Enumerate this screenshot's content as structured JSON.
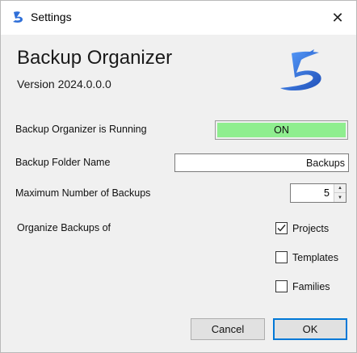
{
  "window": {
    "title": "Settings",
    "close_symbol": "✕"
  },
  "header": {
    "app_name": "Backup Organizer",
    "version": "Version 2024.0.0.0",
    "logo_icon": "stylized-b-logo-icon"
  },
  "form": {
    "running_label": "Backup Organizer is Running",
    "running_status": "ON",
    "running_status_color": "#8fee8f",
    "folder_label": "Backup Folder Name",
    "folder_value": "Backups",
    "max_label": "Maximum Number of Backups",
    "max_value": "5",
    "organize_label": "Organize Backups of",
    "options": [
      {
        "label": "Projects",
        "checked": true
      },
      {
        "label": "Templates",
        "checked": false
      },
      {
        "label": "Families",
        "checked": false
      }
    ]
  },
  "buttons": {
    "cancel": "Cancel",
    "ok": "OK"
  },
  "colors": {
    "accent": "#0078d7",
    "logo_blue": "#2f6fd8"
  }
}
